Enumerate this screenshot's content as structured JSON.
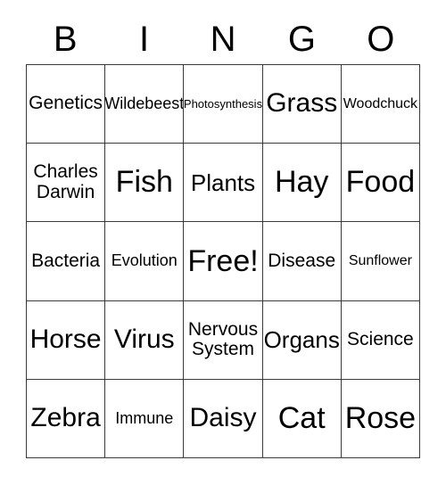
{
  "card": {
    "header_letters": [
      "B",
      "I",
      "N",
      "G",
      "O"
    ],
    "columns": 5,
    "rows": 5,
    "free_space_label": "Free!",
    "free_space_position": {
      "row": 3,
      "column": 3
    },
    "border_color": "#3a3a3a",
    "background_color": "#ffffff",
    "text_color": "#000000",
    "cells": [
      [
        {
          "label": "Genetics",
          "size": "md"
        },
        {
          "label": "Wildebeest",
          "size": "sm"
        },
        {
          "label": "Photosynthesis",
          "size": "xxs"
        },
        {
          "label": "Grass",
          "size": "xl"
        },
        {
          "label": "Woodchuck",
          "size": "xs"
        }
      ],
      [
        {
          "label": "Charles\nDarwin",
          "size": "md"
        },
        {
          "label": "Fish",
          "size": "xxl"
        },
        {
          "label": "Plants",
          "size": "lg"
        },
        {
          "label": "Hay",
          "size": "xxl"
        },
        {
          "label": "Food",
          "size": "xxl"
        }
      ],
      [
        {
          "label": "Bacteria",
          "size": "md"
        },
        {
          "label": "Evolution",
          "size": "sm"
        },
        {
          "label": "Free!",
          "size": "xxl"
        },
        {
          "label": "Disease",
          "size": "md"
        },
        {
          "label": "Sunflower",
          "size": "xs"
        }
      ],
      [
        {
          "label": "Horse",
          "size": "xl"
        },
        {
          "label": "Virus",
          "size": "xl"
        },
        {
          "label": "Nervous\nSystem",
          "size": "md"
        },
        {
          "label": "Organs",
          "size": "lg"
        },
        {
          "label": "Science",
          "size": "md"
        }
      ],
      [
        {
          "label": "Zebra",
          "size": "xl"
        },
        {
          "label": "Immune",
          "size": "sm"
        },
        {
          "label": "Daisy",
          "size": "xl"
        },
        {
          "label": "Cat",
          "size": "xxl"
        },
        {
          "label": "Rose",
          "size": "xxl"
        }
      ]
    ]
  }
}
